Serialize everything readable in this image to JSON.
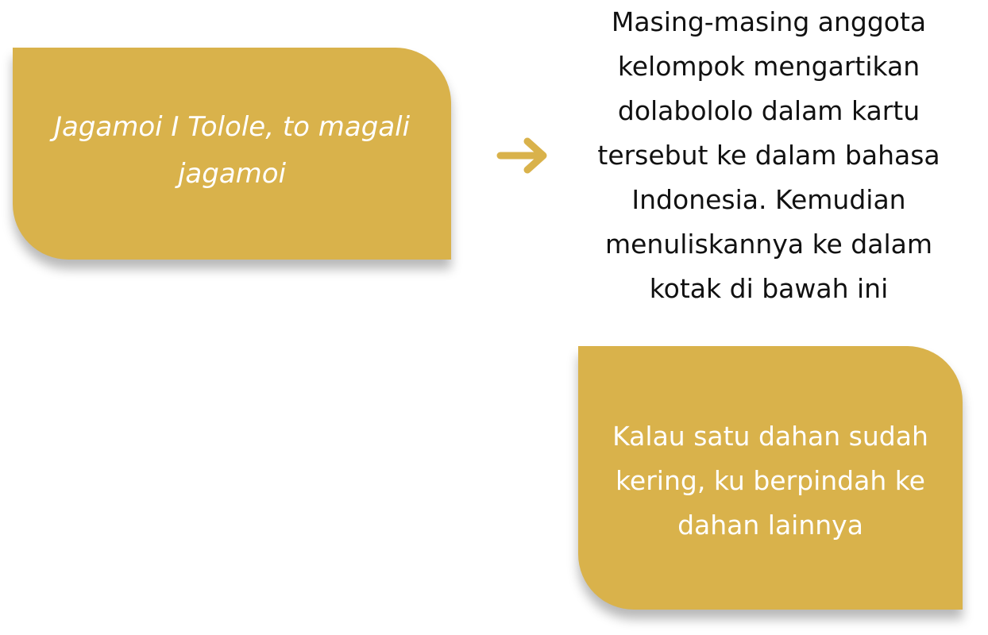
{
  "left_card": {
    "text": "Jagamoi I Tolole, to magali jagamoi"
  },
  "instruction": {
    "text": "Masing-masing anggota kelompok mengartikan dolabololo dalam kartu tersebut ke dalam bahasa Indonesia. Kemudian menuliskannya ke dalam kotak di bawah ini"
  },
  "right_card": {
    "text": "Kalau satu dahan sudah kering, ku berpindah ke dahan lainnya"
  },
  "arrow": {
    "icon": "arrow-right-icon"
  },
  "colors": {
    "card": "#d9b24b",
    "text_on_card": "#ffffff",
    "body_text": "#111111"
  }
}
